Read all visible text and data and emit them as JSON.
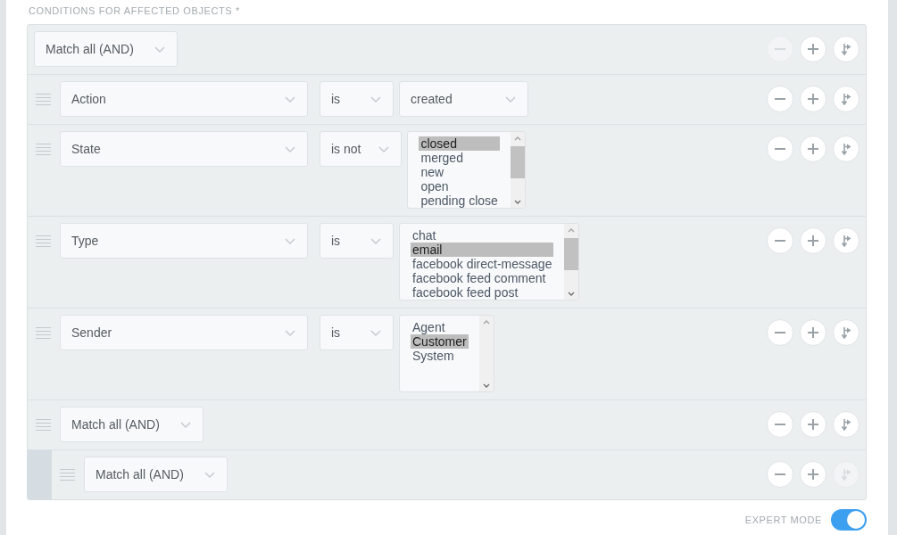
{
  "section_label": "CONDITIONS FOR AFFECTED OBJECTS *",
  "condition_tree": {
    "kind": "group",
    "operator": "Match all (AND)",
    "actions": [
      {
        "kind": "remove",
        "disabled": true
      },
      {
        "kind": "add",
        "disabled": false
      },
      {
        "kind": "subclause",
        "disabled": false
      }
    ],
    "children": [
      {
        "kind": "condition",
        "attribute": "Action",
        "operator": "is",
        "value": {
          "kind": "select",
          "text": "created"
        },
        "actions": [
          {
            "kind": "remove",
            "disabled": false
          },
          {
            "kind": "add",
            "disabled": false
          },
          {
            "kind": "subclause",
            "disabled": false
          }
        ]
      },
      {
        "kind": "condition",
        "attribute": "State",
        "operator": "is not",
        "value": {
          "kind": "listbox",
          "options": [
            {
              "label": "closed",
              "selected": true
            },
            {
              "label": "merged",
              "selected": false
            },
            {
              "label": "new",
              "selected": false
            },
            {
              "label": "open",
              "selected": false
            },
            {
              "label": "pending close",
              "selected": false
            }
          ]
        },
        "actions": [
          {
            "kind": "remove",
            "disabled": false
          },
          {
            "kind": "add",
            "disabled": false
          },
          {
            "kind": "subclause",
            "disabled": false
          }
        ]
      },
      {
        "kind": "condition",
        "attribute": "Type",
        "operator": "is",
        "value": {
          "kind": "listbox",
          "options": [
            {
              "label": "chat",
              "selected": false
            },
            {
              "label": "email",
              "selected": true
            },
            {
              "label": "facebook direct-message",
              "selected": false
            },
            {
              "label": "facebook feed comment",
              "selected": false
            },
            {
              "label": "facebook feed post",
              "selected": false
            }
          ]
        },
        "actions": [
          {
            "kind": "remove",
            "disabled": false
          },
          {
            "kind": "add",
            "disabled": false
          },
          {
            "kind": "subclause",
            "disabled": false
          }
        ]
      },
      {
        "kind": "condition",
        "attribute": "Sender",
        "operator": "is",
        "value": {
          "kind": "listbox",
          "options": [
            {
              "label": "Agent",
              "selected": false
            },
            {
              "label": "Customer",
              "selected": true
            },
            {
              "label": "System",
              "selected": false
            }
          ]
        },
        "actions": [
          {
            "kind": "remove",
            "disabled": false
          },
          {
            "kind": "add",
            "disabled": false
          },
          {
            "kind": "subclause",
            "disabled": false
          }
        ]
      },
      {
        "kind": "group",
        "operator": "Match all (AND)",
        "actions": [
          {
            "kind": "remove",
            "disabled": false
          },
          {
            "kind": "add",
            "disabled": false
          },
          {
            "kind": "subclause",
            "disabled": false
          }
        ],
        "children": [
          {
            "kind": "group",
            "operator": "Match all (AND)",
            "actions": [
              {
                "kind": "remove",
                "disabled": false
              },
              {
                "kind": "add",
                "disabled": false
              },
              {
                "kind": "subclause",
                "disabled": true
              }
            ]
          }
        ]
      }
    ]
  },
  "expert_mode": {
    "label": "EXPERT MODE",
    "on": true
  }
}
